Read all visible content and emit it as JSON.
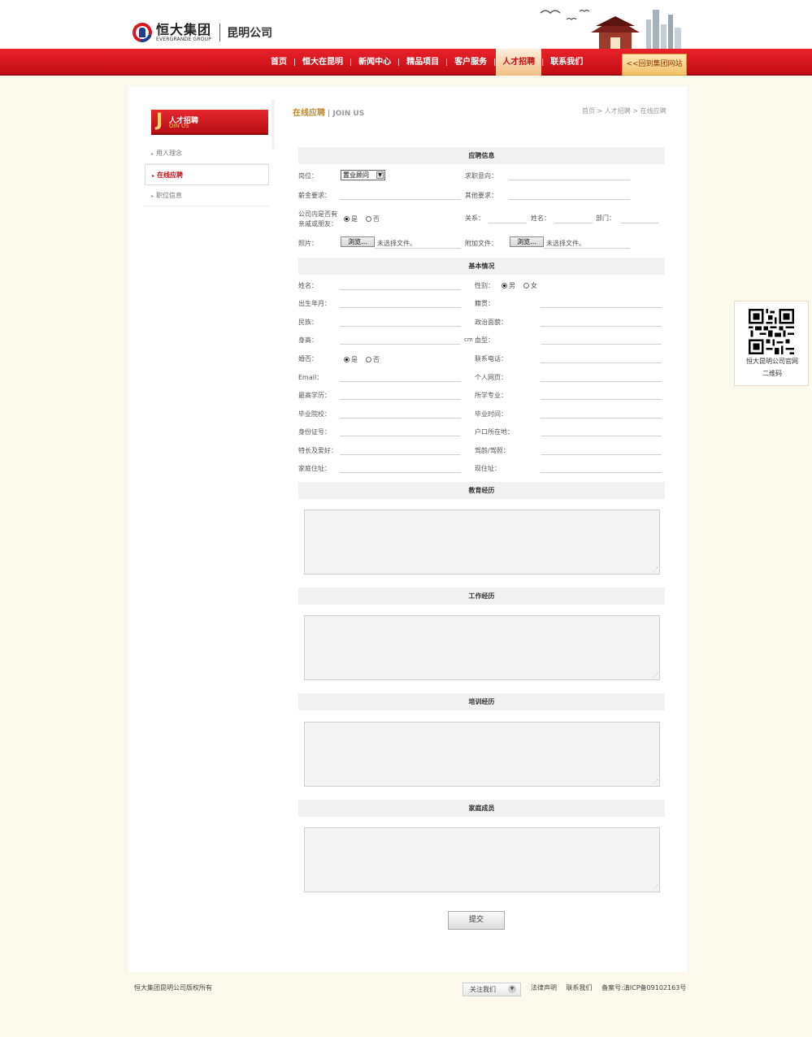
{
  "header": {
    "logo_cn": "恒大集团",
    "logo_en": "EVERGRANDE GROUP",
    "company": "昆明公司"
  },
  "nav": {
    "items": [
      "首页",
      "恒大在昆明",
      "新闻中心",
      "精品项目",
      "客户服务",
      "人才招聘",
      "联系我们"
    ],
    "active": "人才招聘",
    "back": "<<回到集团网站"
  },
  "sidebar": {
    "head_letter": "J",
    "head_cn": "人才招聘",
    "head_en": "OIN US",
    "items": [
      "用人理念",
      "在线应聘",
      "职位信息"
    ]
  },
  "page": {
    "title": "在线应聘",
    "title_en": "| JOIN US",
    "breadcrumb": "首页 > 人才招聘 > 在线应聘"
  },
  "apply": {
    "section": "应聘信息",
    "position_label": "岗位：",
    "position_value": "置业顾问",
    "intent_label": "求职意向：",
    "salary_label": "薪金要求：",
    "other_label": "其他要求：",
    "relative_label_1": "公司内是否有",
    "relative_label_2": "亲戚或朋友：",
    "yes": "是",
    "no": "否",
    "relation_label": "关系：",
    "name_label": "姓名：",
    "dept_label": "部门：",
    "photo_label": "照片：",
    "browse": "浏览...",
    "no_file": "未选择文件。",
    "attach_label": "附加文件："
  },
  "basic": {
    "section": "基本情况",
    "left": [
      "姓名：",
      "出生年月：",
      "民族：",
      "身高：",
      "婚否：",
      "Email：",
      "最高学历：",
      "毕业院校：",
      "身份证号：",
      "特长及爱好：",
      "家庭住址："
    ],
    "right": [
      "性别：",
      "籍贯：",
      "政治面貌：",
      "血型：",
      "联系电话：",
      "个人网页：",
      "所学专业：",
      "毕业时间：",
      "户口所在地：",
      "驾龄/驾照：",
      "现住址："
    ],
    "male": "男",
    "female": "女",
    "married_yes": "是",
    "married_no": "否",
    "cm": "cm"
  },
  "sections": {
    "education": "教育经历",
    "work": "工作经历",
    "training": "培训经历",
    "family": "家庭成员"
  },
  "submit": "提交",
  "qr": {
    "line1": "恒大昆明公司官网",
    "line2": "二维码"
  },
  "footer": {
    "copyright": "恒大集团昆明公司版权所有",
    "follow": "关注我们",
    "legal": "法律声明",
    "contact": "联系我们",
    "icp": "备案号:滇ICP备09102163号"
  }
}
